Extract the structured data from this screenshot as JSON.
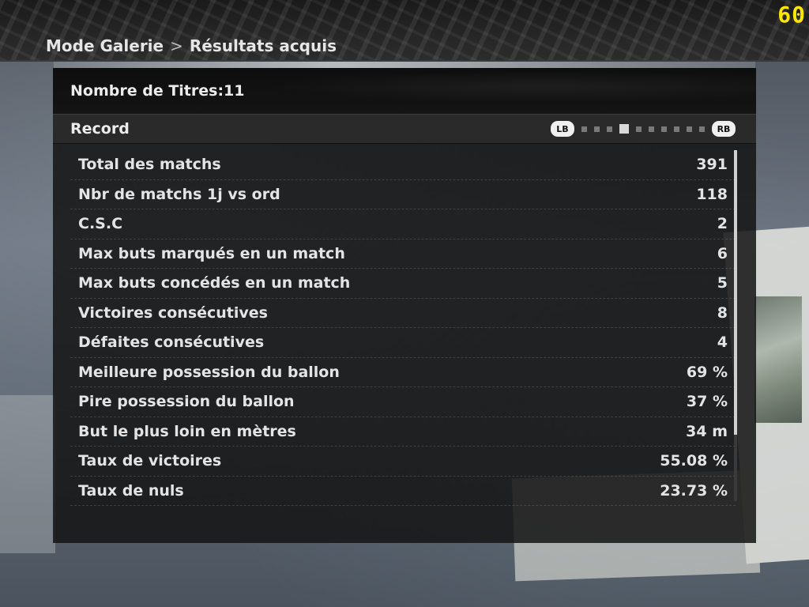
{
  "header": {
    "breadcrumb": [
      "Mode Galerie",
      "Résultats acquis"
    ],
    "separator": ">",
    "fps": "60"
  },
  "panel": {
    "titles_label": "Nombre de Titres:11",
    "section_title": "Record",
    "pager": {
      "left_button": "LB",
      "right_button": "RB",
      "pages": 10,
      "active_index": 3
    }
  },
  "records": [
    {
      "label": "Total des matchs",
      "value": "391"
    },
    {
      "label": "Nbr de matchs 1j vs ord",
      "value": "118"
    },
    {
      "label": "C.S.C",
      "value": "2"
    },
    {
      "label": "Max buts marqués en un match",
      "value": "6"
    },
    {
      "label": "Max buts concédés en un match",
      "value": "5"
    },
    {
      "label": "Victoires consécutives",
      "value": "8"
    },
    {
      "label": "Défaites consécutives",
      "value": "4"
    },
    {
      "label": "Meilleure possession du ballon",
      "value": "69 %"
    },
    {
      "label": "Pire possession du ballon",
      "value": "37 %"
    },
    {
      "label": "But le plus loin en mètres",
      "value": "34 m"
    },
    {
      "label": "Taux de victoires",
      "value": "55.08 %"
    },
    {
      "label": "Taux de nuls",
      "value": "23.73 %"
    }
  ]
}
